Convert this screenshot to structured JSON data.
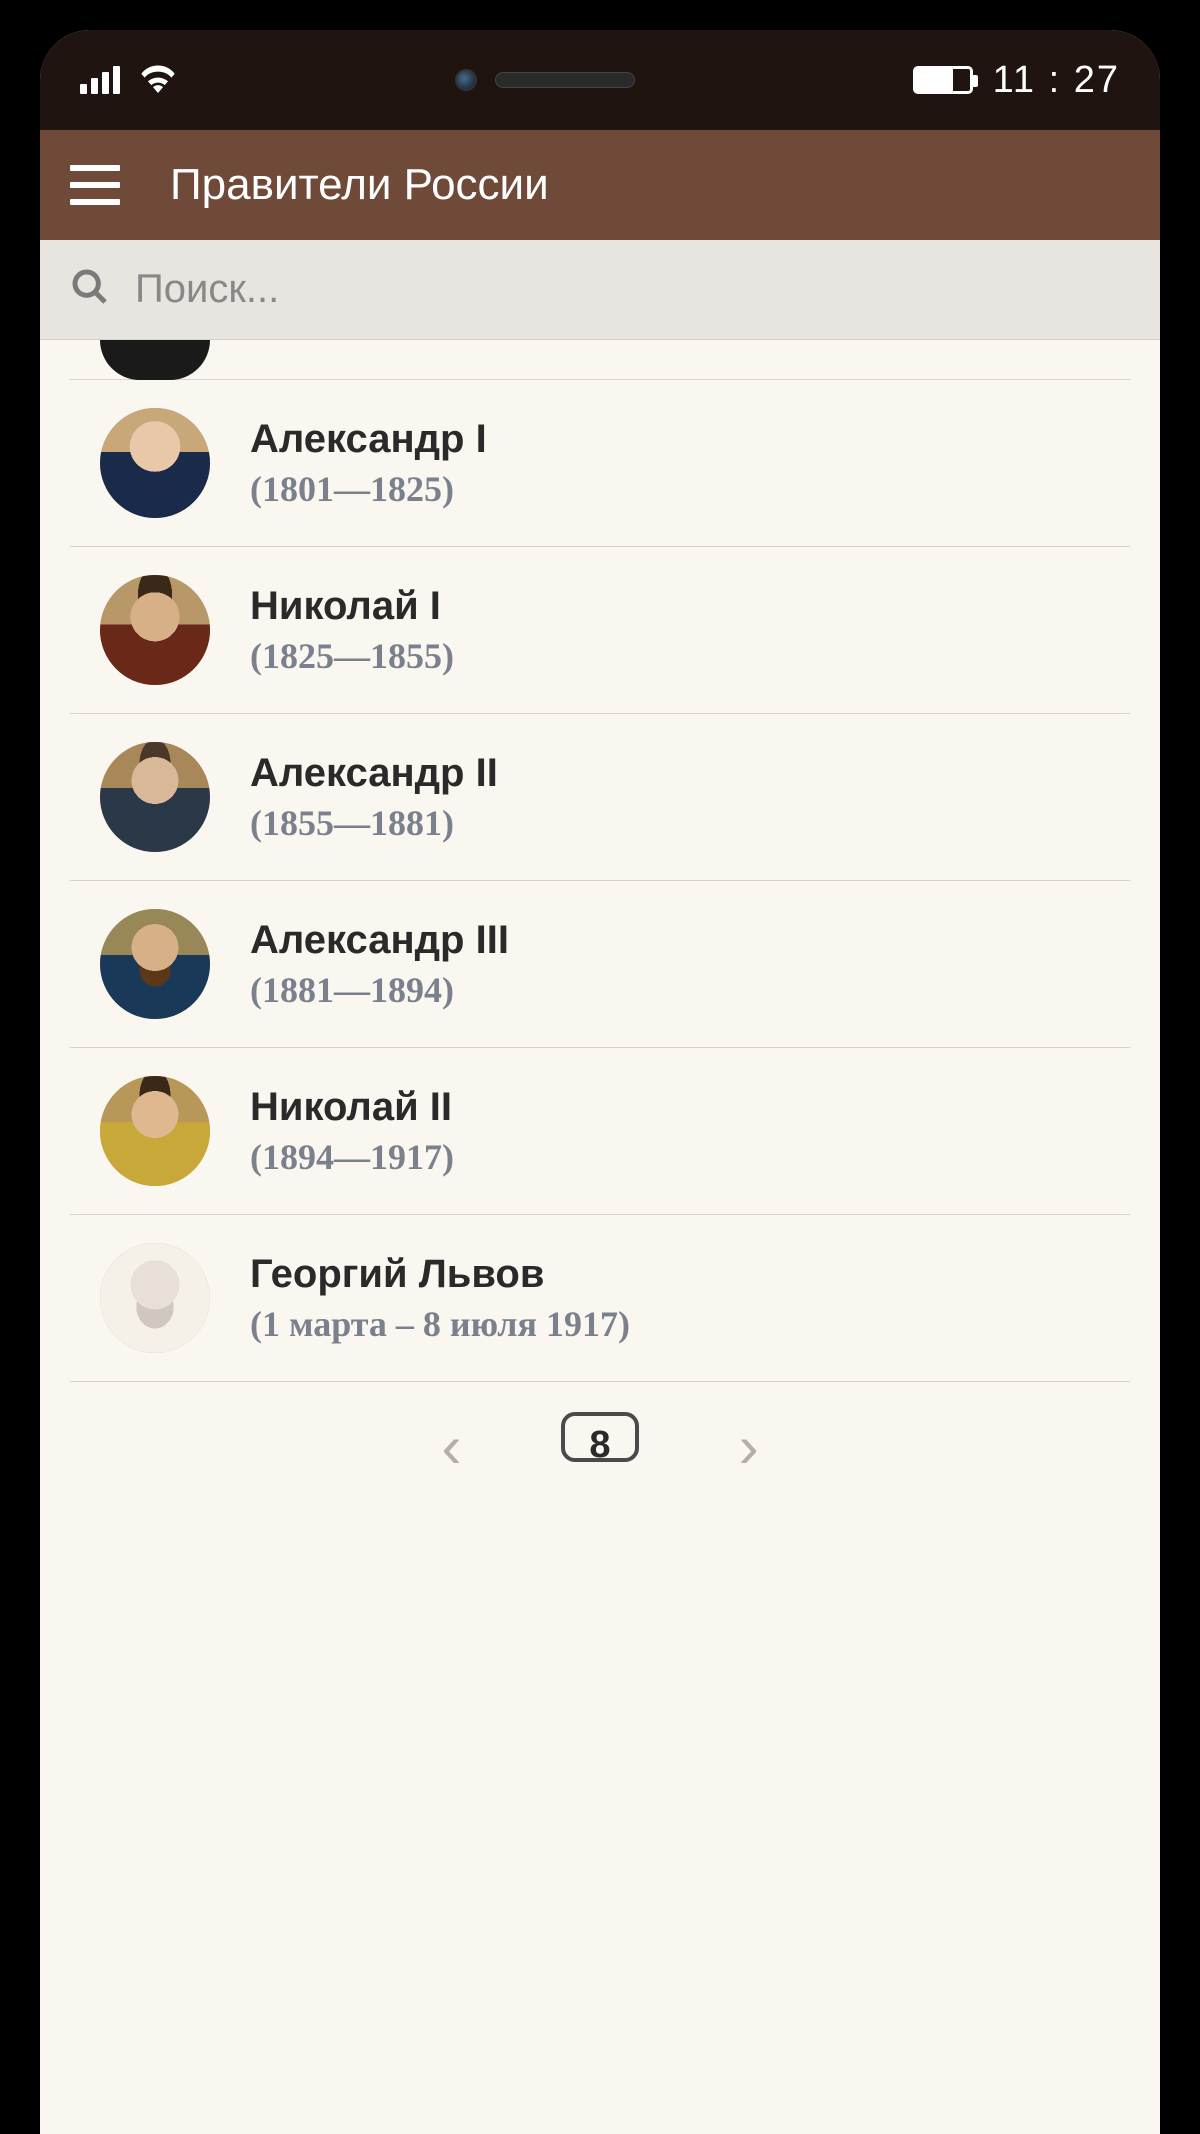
{
  "status": {
    "time": "11 : 27"
  },
  "header": {
    "title": "Правители России"
  },
  "search": {
    "placeholder": "Поиск..."
  },
  "list": {
    "items": [
      {
        "name": "Александр I",
        "years": "(1801—1825)",
        "avatar_class": "av-1"
      },
      {
        "name": "Николай I",
        "years": "(1825—1855)",
        "avatar_class": "av-2"
      },
      {
        "name": "Александр II",
        "years": "(1855—1881)",
        "avatar_class": "av-3"
      },
      {
        "name": "Александр III",
        "years": "(1881—1894)",
        "avatar_class": "av-4"
      },
      {
        "name": "Николай II",
        "years": "(1894—1917)",
        "avatar_class": "av-5"
      },
      {
        "name": "Георгий Львов",
        "years": "(1 марта – 8 июля 1917)",
        "avatar_class": "av-6"
      }
    ]
  },
  "pager": {
    "prev": "‹",
    "page": "8",
    "next": "›"
  }
}
